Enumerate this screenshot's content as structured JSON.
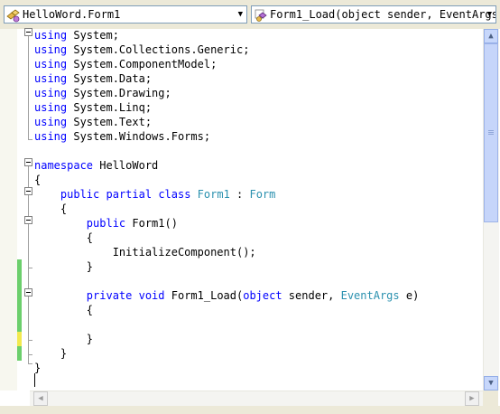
{
  "navbar": {
    "type_combo": {
      "value": "HelloWord.Form1",
      "icon": "class-icon"
    },
    "member_combo": {
      "value": "Form1_Load(object sender, EventArgs e)",
      "icon": "method-icon"
    }
  },
  "code_lines": [
    {
      "indent": "",
      "parts": [
        {
          "t": "kw",
          "s": "using"
        },
        {
          "t": "tx",
          "s": " System;"
        }
      ]
    },
    {
      "indent": "",
      "parts": [
        {
          "t": "kw",
          "s": "using"
        },
        {
          "t": "tx",
          "s": " System.Collections.Generic;"
        }
      ]
    },
    {
      "indent": "",
      "parts": [
        {
          "t": "kw",
          "s": "using"
        },
        {
          "t": "tx",
          "s": " System.ComponentModel;"
        }
      ]
    },
    {
      "indent": "",
      "parts": [
        {
          "t": "kw",
          "s": "using"
        },
        {
          "t": "tx",
          "s": " System.Data;"
        }
      ]
    },
    {
      "indent": "",
      "parts": [
        {
          "t": "kw",
          "s": "using"
        },
        {
          "t": "tx",
          "s": " System.Drawing;"
        }
      ]
    },
    {
      "indent": "",
      "parts": [
        {
          "t": "kw",
          "s": "using"
        },
        {
          "t": "tx",
          "s": " System.Linq;"
        }
      ]
    },
    {
      "indent": "",
      "parts": [
        {
          "t": "kw",
          "s": "using"
        },
        {
          "t": "tx",
          "s": " System.Text;"
        }
      ]
    },
    {
      "indent": "",
      "parts": [
        {
          "t": "kw",
          "s": "using"
        },
        {
          "t": "tx",
          "s": " System.Windows.Forms;"
        }
      ]
    },
    {
      "indent": "",
      "parts": []
    },
    {
      "indent": "",
      "parts": [
        {
          "t": "kw",
          "s": "namespace"
        },
        {
          "t": "tx",
          "s": " HelloWord"
        }
      ]
    },
    {
      "indent": "",
      "parts": [
        {
          "t": "tx",
          "s": "{"
        }
      ]
    },
    {
      "indent": "    ",
      "parts": [
        {
          "t": "kw",
          "s": "public"
        },
        {
          "t": "tx",
          "s": " "
        },
        {
          "t": "kw",
          "s": "partial"
        },
        {
          "t": "tx",
          "s": " "
        },
        {
          "t": "kw",
          "s": "class"
        },
        {
          "t": "tx",
          "s": " "
        },
        {
          "t": "ty",
          "s": "Form1"
        },
        {
          "t": "tx",
          "s": " : "
        },
        {
          "t": "ty",
          "s": "Form"
        }
      ]
    },
    {
      "indent": "    ",
      "parts": [
        {
          "t": "tx",
          "s": "{"
        }
      ]
    },
    {
      "indent": "        ",
      "parts": [
        {
          "t": "kw",
          "s": "public"
        },
        {
          "t": "tx",
          "s": " Form1()"
        }
      ]
    },
    {
      "indent": "        ",
      "parts": [
        {
          "t": "tx",
          "s": "{"
        }
      ]
    },
    {
      "indent": "            ",
      "parts": [
        {
          "t": "tx",
          "s": "InitializeComponent();"
        }
      ]
    },
    {
      "indent": "        ",
      "parts": [
        {
          "t": "tx",
          "s": "}"
        }
      ]
    },
    {
      "indent": "",
      "parts": []
    },
    {
      "indent": "        ",
      "parts": [
        {
          "t": "kw",
          "s": "private"
        },
        {
          "t": "tx",
          "s": " "
        },
        {
          "t": "kw",
          "s": "void"
        },
        {
          "t": "tx",
          "s": " Form1_Load("
        },
        {
          "t": "kw",
          "s": "object"
        },
        {
          "t": "tx",
          "s": " sender, "
        },
        {
          "t": "ty",
          "s": "EventArgs"
        },
        {
          "t": "tx",
          "s": " e)"
        }
      ]
    },
    {
      "indent": "        ",
      "parts": [
        {
          "t": "tx",
          "s": "{"
        }
      ]
    },
    {
      "indent": "",
      "parts": []
    },
    {
      "indent": "        ",
      "parts": [
        {
          "t": "tx",
          "s": "}"
        }
      ]
    },
    {
      "indent": "    ",
      "parts": [
        {
          "t": "tx",
          "s": "}"
        }
      ]
    },
    {
      "indent": "",
      "parts": [
        {
          "t": "tx",
          "s": "}"
        }
      ]
    },
    {
      "indent": "",
      "parts": []
    }
  ],
  "change_markers": [
    {
      "line": 16,
      "state": "saved"
    },
    {
      "line": 17,
      "state": "saved"
    },
    {
      "line": 18,
      "state": "saved"
    },
    {
      "line": 19,
      "state": "saved"
    },
    {
      "line": 20,
      "state": "saved"
    },
    {
      "line": 21,
      "state": "unsaved"
    },
    {
      "line": 22,
      "state": "saved"
    }
  ],
  "colors": {
    "keyword": "#0000ff",
    "type": "#2b91af",
    "text": "#000000",
    "saved_change": "#6ccf6c",
    "unsaved_change": "#f2e94e"
  },
  "icons": {
    "scroll_up": "scroll-up-arrow-icon",
    "scroll_down": "scroll-down-arrow-icon",
    "scroll_left": "scroll-left-arrow-icon",
    "scroll_right": "scroll-right-arrow-icon",
    "collapse": "collapse-minus-icon"
  }
}
